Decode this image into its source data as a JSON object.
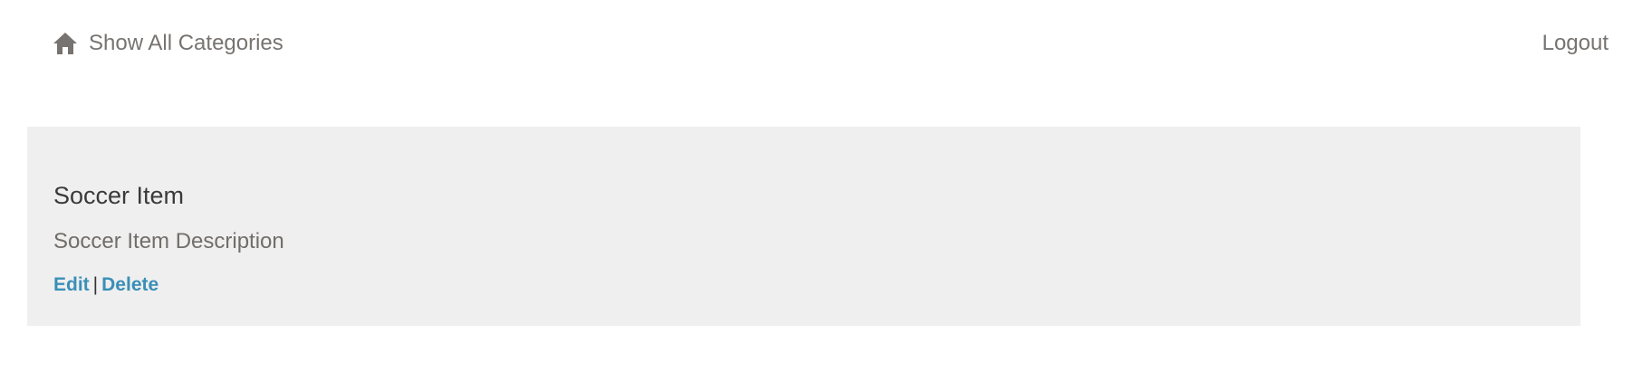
{
  "nav": {
    "home_icon": "home-icon",
    "home_label": "Show All Categories",
    "logout_label": "Logout"
  },
  "item": {
    "title": "Soccer Item",
    "description": "Soccer Item Description",
    "edit_label": "Edit",
    "separator": "|",
    "delete_label": "Delete"
  },
  "colors": {
    "nav_text": "#777370",
    "panel_background": "#efefef",
    "link": "#3a8fb7"
  }
}
